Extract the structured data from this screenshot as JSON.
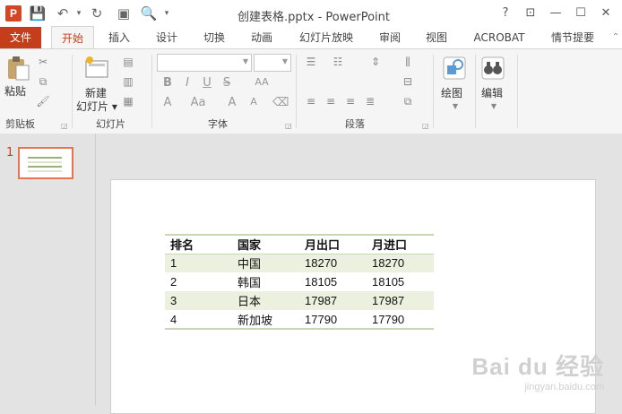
{
  "window": {
    "title": "创建表格.pptx - PowerPoint",
    "app_icon": "P",
    "controls": [
      "?",
      "⊡",
      "—",
      "☐",
      "✕"
    ]
  },
  "tabs": {
    "file": "文件",
    "items": [
      "开始",
      "插入",
      "设计",
      "切换",
      "动画",
      "幻灯片放映",
      "审阅",
      "视图",
      "ACROBAT",
      "情节提要"
    ],
    "active": "开始"
  },
  "ribbon": {
    "clipboard": {
      "paste": "粘贴",
      "label": "剪贴板"
    },
    "slides": {
      "new_line1": "新建",
      "new_line2": "幻灯片 ▾",
      "label": "幻灯片"
    },
    "font": {
      "label": "字体",
      "buttons": [
        "B",
        "I",
        "U",
        "S",
        "AA",
        "Aa",
        "A",
        "A"
      ]
    },
    "paragraph": {
      "label": "段落"
    },
    "drawing": {
      "label": "绘图"
    },
    "editing": {
      "label": "编辑"
    }
  },
  "thumbnail": {
    "number": "1"
  },
  "slide_table": {
    "headers": [
      "排名",
      "国家",
      "月出口",
      "月进口"
    ],
    "rows": [
      [
        "1",
        "中国",
        "18270",
        "18270"
      ],
      [
        "2",
        "韩国",
        "18105",
        "18105"
      ],
      [
        "3",
        "日本",
        "17987",
        "17987"
      ],
      [
        "4",
        "新加坡",
        "17790",
        "17790"
      ]
    ]
  },
  "watermark": {
    "main": "Bai du 经验",
    "sub": "jingyan.baidu.com"
  }
}
